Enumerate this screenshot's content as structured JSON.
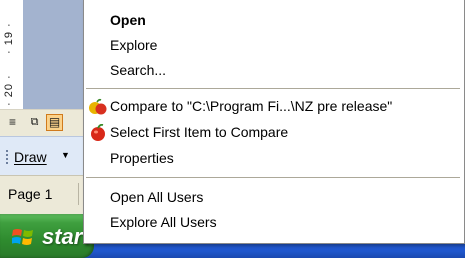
{
  "background_app": {
    "ruler_labels": [
      "· 19 ·",
      "· 20 ·"
    ],
    "view_buttons": [
      {
        "icon": "normal-view-icon",
        "glyph": "≡"
      },
      {
        "icon": "web-layout-icon",
        "glyph": "⧉"
      },
      {
        "icon": "print-layout-icon",
        "glyph": "▤"
      }
    ],
    "draw_toolbar": {
      "label": "Draw",
      "arrow": "▼"
    },
    "status_bar": {
      "page_label": "Page 1"
    }
  },
  "taskbar": {
    "start_label": "start"
  },
  "context_menu": {
    "items": [
      {
        "label": "Open",
        "bold": true
      },
      {
        "label": "Explore"
      },
      {
        "label": "Search..."
      },
      {
        "label": "Compare to \"C:\\Program Fi...\\NZ pre release\"",
        "icon": "compare-apples-icon"
      },
      {
        "label": "Select First Item to Compare",
        "icon": "apple-icon"
      },
      {
        "label": "Properties"
      },
      {
        "label": "Open All Users"
      },
      {
        "label": "Explore All Users"
      }
    ]
  },
  "colors": {
    "taskbar_blue": "#245edb",
    "start_green": "#3f9f3f",
    "menu_background": "#ffffff",
    "menu_separator": "#aca899",
    "draw_toolbar_bg": "#dfe9f7",
    "selected_view_button": "#fbd28a"
  }
}
